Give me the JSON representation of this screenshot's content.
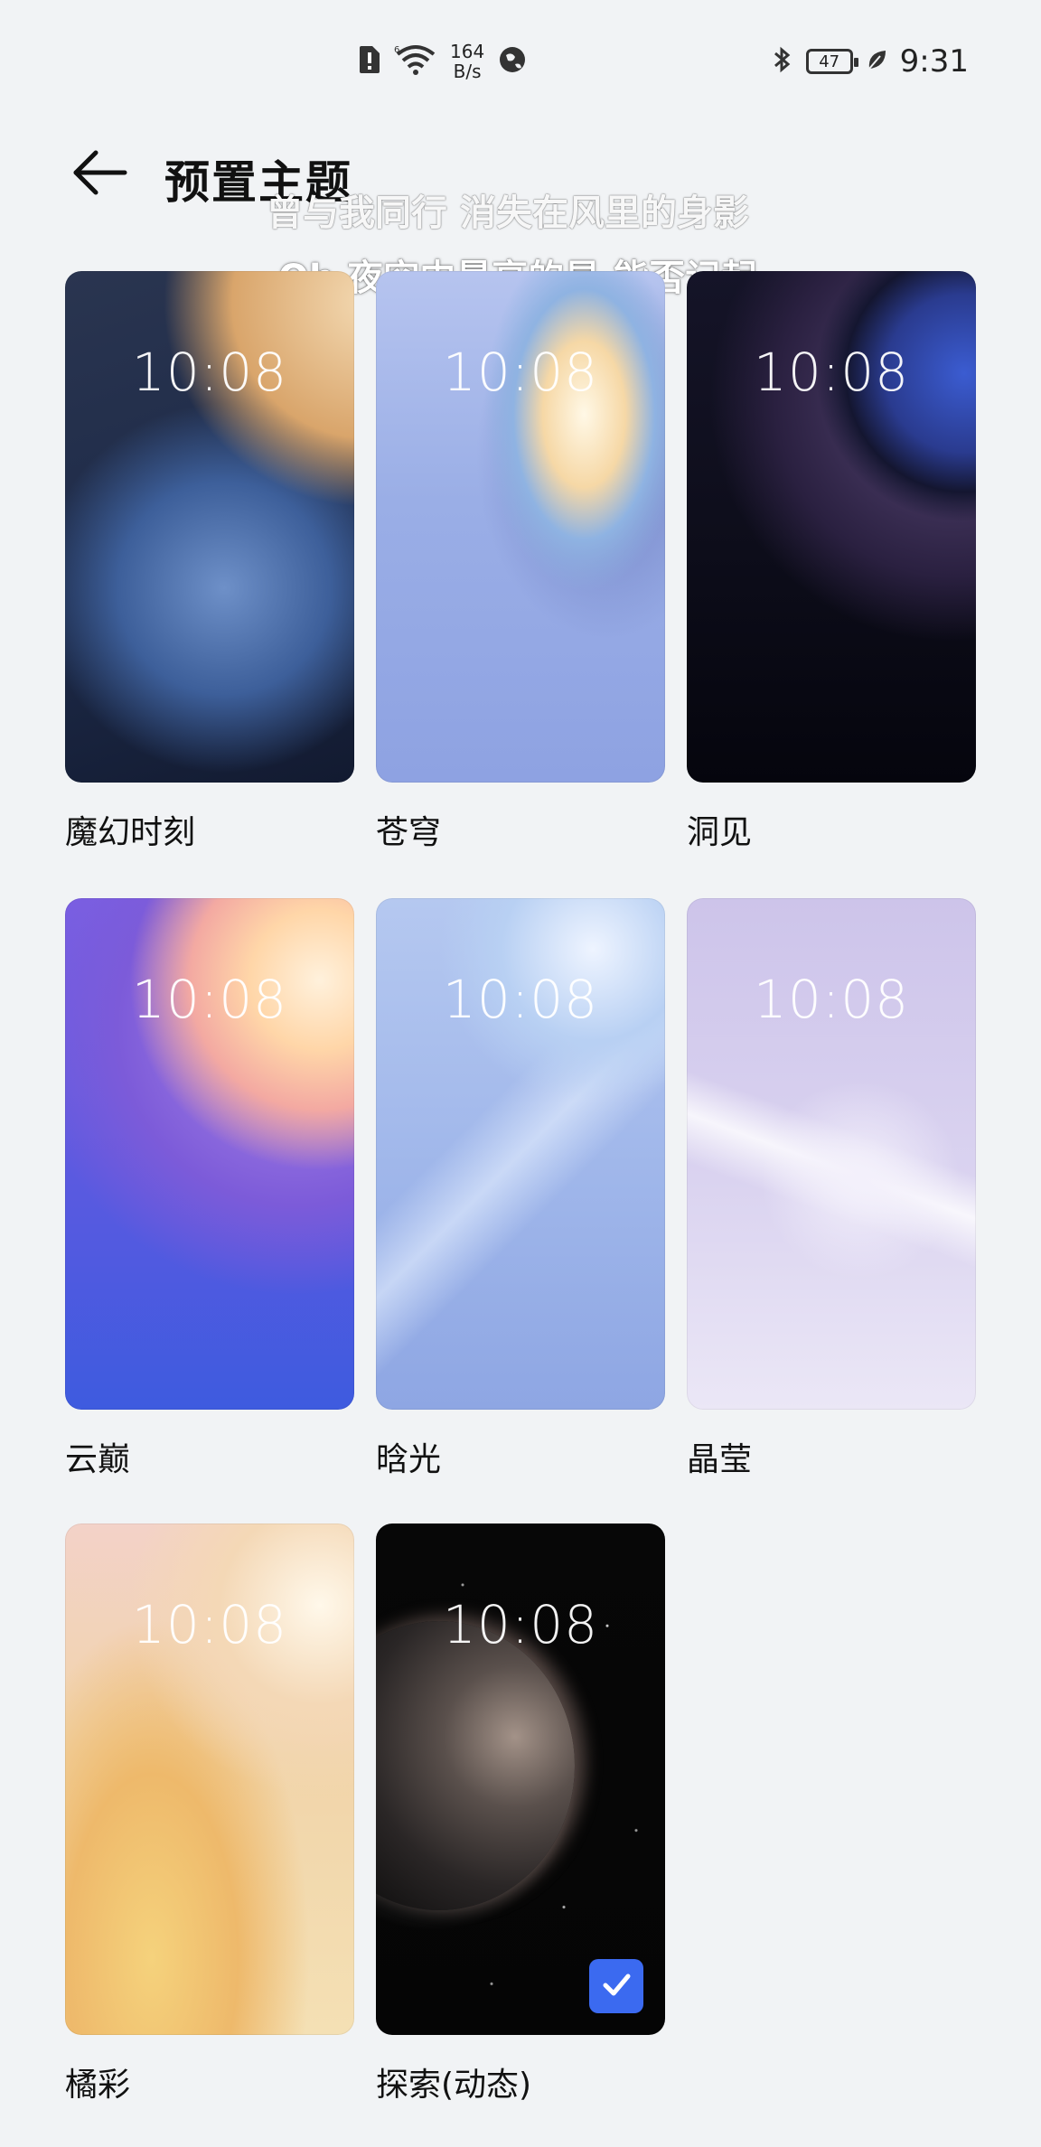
{
  "status_bar": {
    "net_speed_value": "164",
    "net_speed_unit": "B/s",
    "battery": "47",
    "time": "9:31",
    "icons": [
      "alert-icon",
      "wifi-icon",
      "globe-icon",
      "bluetooth-icon",
      "battery-icon",
      "leaf-icon"
    ]
  },
  "header": {
    "title": "预置主题",
    "back_icon": "arrow-left-icon"
  },
  "lyrics": {
    "line1": "曾与我同行 消失在风里的身影",
    "line2": "Oh 夜空中最亮的星 能否记起"
  },
  "themes": [
    {
      "name": "魔幻时刻",
      "time": "10:08",
      "selected": false
    },
    {
      "name": "苍穹",
      "time": "10:08",
      "selected": false
    },
    {
      "name": "洞见",
      "time": "10:08",
      "selected": false
    },
    {
      "name": "云巅",
      "time": "10:08",
      "selected": false
    },
    {
      "name": "晗光",
      "time": "10:08",
      "selected": false
    },
    {
      "name": "晶莹",
      "time": "10:08",
      "selected": false
    },
    {
      "name": "橘彩",
      "time": "10:08",
      "selected": false
    },
    {
      "name": "探索(动态)",
      "time": "10:08",
      "selected": true
    }
  ],
  "colors": {
    "background": "#f1f3f5",
    "accent": "#3b6af0"
  }
}
